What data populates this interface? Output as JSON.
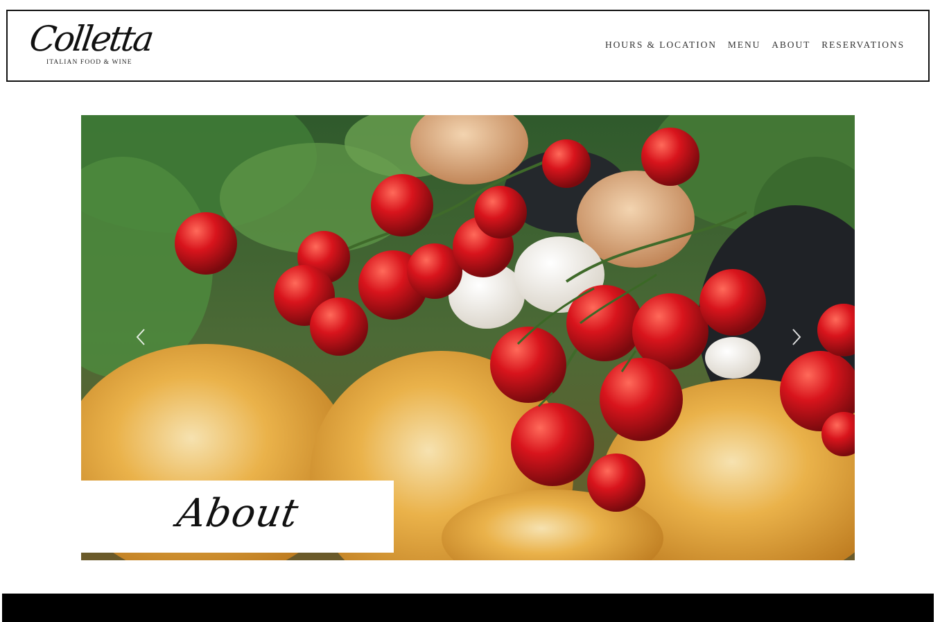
{
  "brand": {
    "name": "Colletta",
    "tagline": "ITALIAN FOOD & WINE"
  },
  "nav": {
    "items": [
      {
        "label": "HOURS & LOCATION"
      },
      {
        "label": "MENU"
      },
      {
        "label": "ABOUT"
      },
      {
        "label": "RESERVATIONS"
      }
    ]
  },
  "hero": {
    "image_description_icon": "hero-food-photo",
    "title": "About",
    "prev_icon": "chevron-left-icon",
    "next_icon": "chevron-right-icon"
  },
  "colors": {
    "text": "#111111",
    "footer": "#000000",
    "background": "#ffffff"
  }
}
